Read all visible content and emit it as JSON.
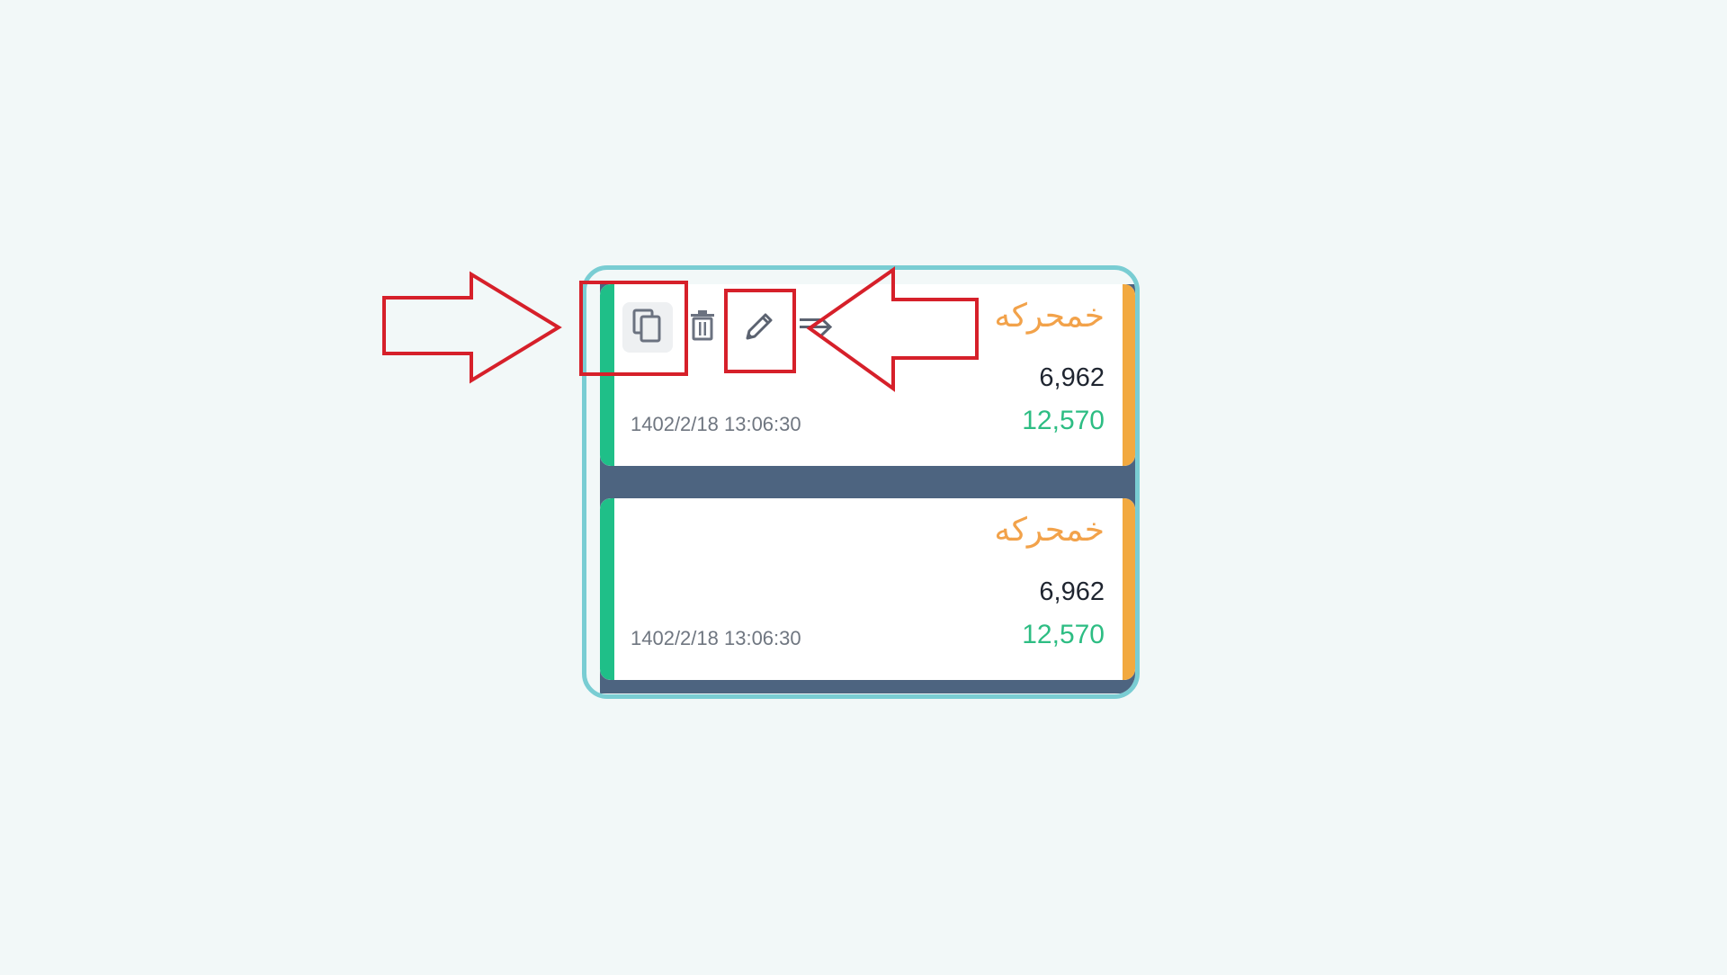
{
  "colors": {
    "background": "#f2f8f8",
    "frame_border": "#79cdd3",
    "panel": "#4d6480",
    "card_left_bar": "#1fbf88",
    "card_right_bar": "#f2a93f",
    "symbol_text": "#f2a24a",
    "volume_text": "#2dbd83",
    "annotation_red": "#d6202a"
  },
  "cards": [
    {
      "symbol": "خمحرکه",
      "price": "6,962",
      "volume": "12,570",
      "datetime": "1402/2/18 13:06:30",
      "actions": [
        {
          "icon": "copy-icon"
        },
        {
          "icon": "trash-icon"
        },
        {
          "icon": "pencil-icon"
        },
        {
          "icon": "move-arrow-icon"
        }
      ]
    },
    {
      "symbol": "خمحرکه",
      "price": "6,962",
      "volume": "12,570",
      "datetime": "1402/2/18 13:06:30"
    }
  ],
  "annotations": [
    {
      "type": "arrow",
      "direction": "right",
      "target": "copy-button"
    },
    {
      "type": "box",
      "target": "copy-button"
    },
    {
      "type": "box",
      "target": "edit-button"
    },
    {
      "type": "arrow",
      "direction": "left",
      "target": "edit-button"
    }
  ]
}
